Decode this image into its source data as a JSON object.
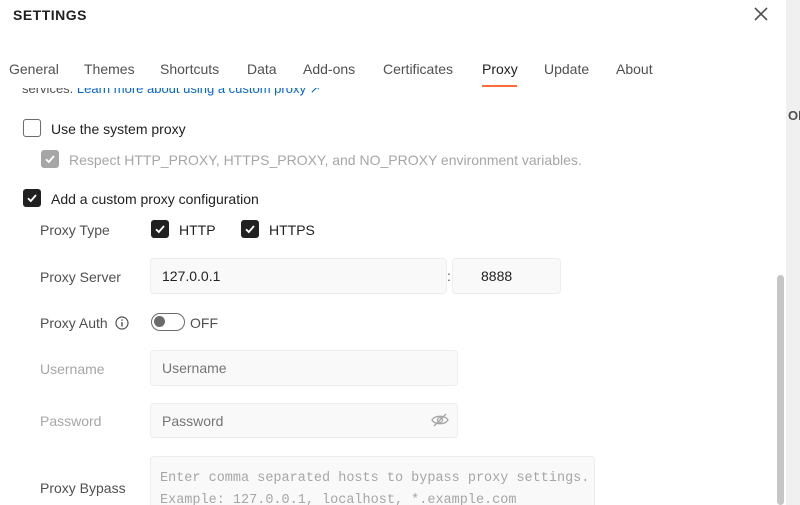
{
  "header": {
    "title": "SETTINGS"
  },
  "tabs": [
    {
      "label": "General"
    },
    {
      "label": "Themes"
    },
    {
      "label": "Shortcuts"
    },
    {
      "label": "Data"
    },
    {
      "label": "Add-ons"
    },
    {
      "label": "Certificates"
    },
    {
      "label": "Proxy"
    },
    {
      "label": "Update"
    },
    {
      "label": "About"
    }
  ],
  "active_tab": "Proxy",
  "intro": {
    "prefix": "services. ",
    "link_text": "Learn more about using a custom proxy ↗"
  },
  "system_proxy": {
    "label": "Use the system proxy",
    "checked": false,
    "respect_env_label": "Respect HTTP_PROXY, HTTPS_PROXY, and NO_PROXY environment variables.",
    "respect_env_checked": true
  },
  "custom_proxy": {
    "label": "Add a custom proxy configuration",
    "checked": true,
    "proxy_type_label": "Proxy Type",
    "http_label": "HTTP",
    "https_label": "HTTPS",
    "proxy_server_label": "Proxy Server",
    "server_value": "127.0.0.1",
    "port_separator": ":",
    "port_value": "8888",
    "proxy_auth_label": "Proxy Auth",
    "auth_state": "OFF",
    "username_label": "Username",
    "username_placeholder": "Username",
    "password_label": "Password",
    "password_placeholder": "Password",
    "bypass_label": "Proxy Bypass",
    "bypass_placeholder_line1": "Enter comma separated hosts to bypass proxy settings.",
    "bypass_placeholder_line2": "Example: 127.0.0.1, localhost, *.example.com"
  },
  "background": {
    "partial_text": "OE"
  },
  "colors": {
    "accent": "#ff6c37",
    "link": "#0265d2",
    "checkbox": "#212121"
  },
  "icons": [
    "close-icon",
    "info-icon",
    "eye-off-icon",
    "checkmark-icon",
    "external-link-icon"
  ]
}
